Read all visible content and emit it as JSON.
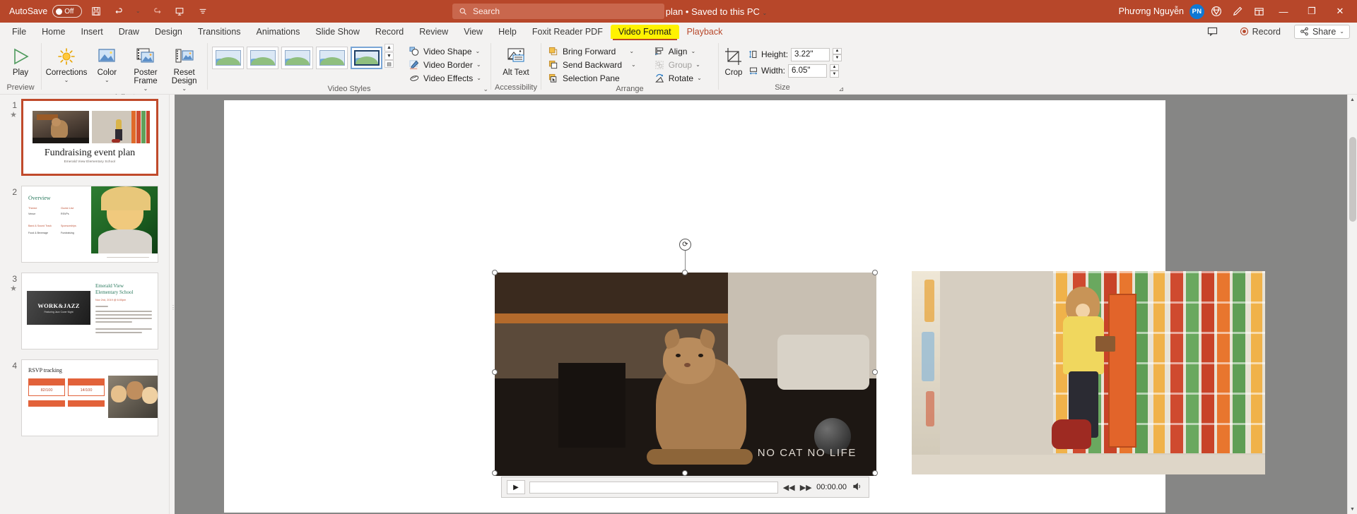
{
  "titlebar": {
    "autosave_label": "AutoSave",
    "autosave_state": "Off",
    "document_title": "Fundraising event plan • Saved to this PC",
    "title_caret": "⌄",
    "icons": [
      "save-icon",
      "undo-icon",
      "undo-dropdown",
      "redo-icon",
      "present-icon",
      "customize-toolbar-icon"
    ],
    "search_placeholder": "Search",
    "user_name": "Phương Nguyễn",
    "user_initials": "PN",
    "window_minimize": "—",
    "window_restore": "❐",
    "window_close": "✕"
  },
  "tabs": [
    {
      "label": "File",
      "state": "normal"
    },
    {
      "label": "Home",
      "state": "normal"
    },
    {
      "label": "Insert",
      "state": "normal"
    },
    {
      "label": "Draw",
      "state": "normal"
    },
    {
      "label": "Design",
      "state": "normal"
    },
    {
      "label": "Transitions",
      "state": "normal"
    },
    {
      "label": "Animations",
      "state": "normal"
    },
    {
      "label": "Slide Show",
      "state": "normal"
    },
    {
      "label": "Record",
      "state": "normal"
    },
    {
      "label": "Review",
      "state": "normal"
    },
    {
      "label": "View",
      "state": "normal"
    },
    {
      "label": "Help",
      "state": "normal"
    },
    {
      "label": "Foxit Reader PDF",
      "state": "normal"
    },
    {
      "label": "Video Format",
      "state": "highlighted"
    },
    {
      "label": "Playback",
      "state": "accent"
    }
  ],
  "tabbar_right": {
    "comments_label": "",
    "record_label": "Record",
    "share_label": "Share",
    "share_caret": "⌄"
  },
  "ribbon": {
    "groups": [
      {
        "name": "Preview",
        "label": "Preview",
        "buttons": [
          {
            "label": "Play",
            "icon": "play-icon"
          }
        ]
      },
      {
        "name": "Adjust",
        "label": "Adjust",
        "buttons": [
          {
            "label": "Corrections",
            "icon": "corrections-icon",
            "caret": "⌄"
          },
          {
            "label": "Color",
            "icon": "color-icon",
            "caret": "⌄"
          },
          {
            "label": "Poster Frame",
            "icon": "poster-frame-icon",
            "caret": "⌄"
          },
          {
            "label": "Reset Design",
            "icon": "reset-design-icon",
            "caret": "⌄"
          }
        ]
      },
      {
        "name": "VideoStyles",
        "label": "Video Styles",
        "gallery_count": 5,
        "gallery_selected_index": 4,
        "scroll_buttons": [
          "▲",
          "▼",
          "▤"
        ],
        "commands": [
          {
            "label": "Video Shape",
            "icon": "video-shape-icon",
            "caret": "⌄"
          },
          {
            "label": "Video Border",
            "icon": "video-border-icon",
            "caret": "⌄"
          },
          {
            "label": "Video Effects",
            "icon": "video-effects-icon",
            "caret": "⌄"
          }
        ]
      },
      {
        "name": "Accessibility",
        "label": "Accessibility",
        "buttons": [
          {
            "label": "Alt Text",
            "icon": "alt-text-icon"
          }
        ]
      },
      {
        "name": "Arrange",
        "label": "Arrange",
        "commands": [
          {
            "label": "Bring Forward",
            "icon": "bring-forward-icon",
            "caret": "⌄",
            "disabled": false
          },
          {
            "label": "Send Backward",
            "icon": "send-backward-icon",
            "caret": "⌄",
            "disabled": false
          },
          {
            "label": "Selection Pane",
            "icon": "selection-pane-icon",
            "caret": "",
            "disabled": false
          },
          {
            "label": "Align",
            "icon": "align-icon",
            "caret": "⌄",
            "disabled": false
          },
          {
            "label": "Group",
            "icon": "group-icon",
            "caret": "⌄",
            "disabled": true
          },
          {
            "label": "Rotate",
            "icon": "rotate-icon",
            "caret": "⌄",
            "disabled": false
          }
        ]
      },
      {
        "name": "Size",
        "label": "Size",
        "crop_label": "Crop",
        "crop_icon": "crop-icon",
        "height_label": "Height:",
        "height_value": "3.22\"",
        "height_icon": "height-icon",
        "width_label": "Width:",
        "width_value": "6.05\"",
        "width_icon": "width-icon",
        "dialog_launcher": "⊿"
      }
    ]
  },
  "thumbnails": [
    {
      "number": "1",
      "has_star": true,
      "selected": true,
      "title": "Fundraising event plan",
      "subtitle": "Emerald View Elementary School"
    },
    {
      "number": "2",
      "has_star": false,
      "selected": false,
      "title": "Overview",
      "subtitle": ""
    },
    {
      "number": "3",
      "has_star": true,
      "selected": false,
      "title": "Emerald View Elementary School",
      "subtitle": "WORK&JAZZ"
    },
    {
      "number": "4",
      "has_star": false,
      "selected": false,
      "title": "RSVP tracking",
      "subtitle": ""
    }
  ],
  "thumb3": {
    "banner_title": "WORK&JAZZ",
    "banner_sub": "Featuring Jazz Cover Night",
    "heading1": "Emerald View",
    "heading2": "Elementary School",
    "date_line": "Nov 2nd, 2019 @ 6:00pm"
  },
  "thumb4": {
    "title": "RSVP tracking",
    "cells": [
      {
        "head": "Sent",
        "value": "82/100"
      },
      {
        "head": "Guest List",
        "value": "14/100"
      },
      {
        "head": "Checks",
        "value": ""
      },
      {
        "head": "Placement",
        "value": ""
      }
    ]
  },
  "thumb2": {
    "title": "Overview",
    "headers": [
      "Theme",
      "Guest List"
    ],
    "rows": [
      [
        "Venue",
        "RSVPs"
      ],
      [
        "Band & Sound Track",
        "Sponsorships"
      ],
      [
        "Food & Beverage",
        "Fundraising"
      ]
    ]
  },
  "slide": {
    "video_caption": "NO CAT NO LIFE",
    "selection_handles": 8,
    "rotation_handle_icon": "rotate-handle-icon"
  },
  "media_bar": {
    "play_icon": "▶",
    "prev_icon": "◀◀",
    "next_icon": "▶▶",
    "time": "00:00.00",
    "volume_icon": "volume-icon"
  }
}
